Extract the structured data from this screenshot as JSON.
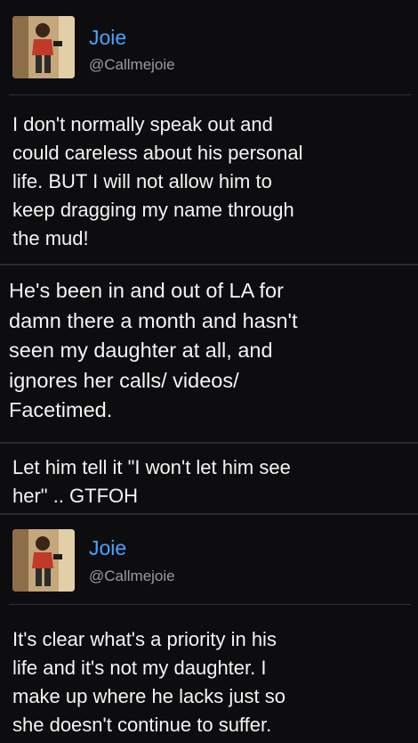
{
  "tweets": [
    {
      "author": {
        "name": "Joie",
        "handle": "@Callmejoie",
        "avatar_icon": "profile-photo"
      },
      "text": "I don't normally speak out and\ncould careless about his personal\nlife. BUT I will not allow him to\nkeep dragging my name through\nthe mud!"
    },
    {
      "text": "He's been in and out of LA for\ndamn there a month and hasn't\nseen my daughter at all, and\nignores her calls/ videos/\nFacetimed."
    },
    {
      "text": "Let him tell it \"I won't let him see\nher\" .. GTFOH"
    },
    {
      "author": {
        "name": "Joie",
        "handle": "@Callmejoie",
        "avatar_icon": "profile-photo"
      },
      "text": "It's clear what's a priority in his\nlife and it's not my daughter. I\nmake up where he lacks just so\nshe doesn't continue to suffer."
    }
  ],
  "colors": {
    "name": "#4aa3ff",
    "handle": "#9a9aa2",
    "background": "#0d0d10"
  }
}
